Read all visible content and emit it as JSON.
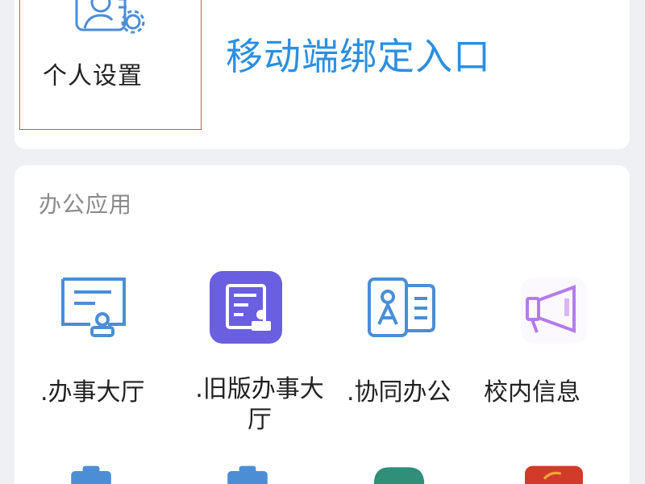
{
  "top": {
    "settings_label": "个人设置",
    "mobile_binding_label": "移动端绑定入口"
  },
  "office": {
    "section_title": "办公应用",
    "apps": [
      {
        "label": ".办事大厅",
        "icon": "document-stamp-icon"
      },
      {
        "label": ".旧版办事大厅",
        "icon": "document-form-icon"
      },
      {
        "label": ".协同办公",
        "icon": "id-card-icon"
      },
      {
        "label": "校内信息",
        "icon": "megaphone-icon"
      }
    ],
    "second_row_icons": [
      "clipboard-icon",
      "clipboard-icon",
      "screen-icon",
      "red-app-icon"
    ]
  },
  "colors": {
    "accent_blue": "#2c8fe0",
    "icon_purple": "#6a5fe0",
    "highlight_red": "#d9534f",
    "megaphone_purple": "#b57bea"
  }
}
